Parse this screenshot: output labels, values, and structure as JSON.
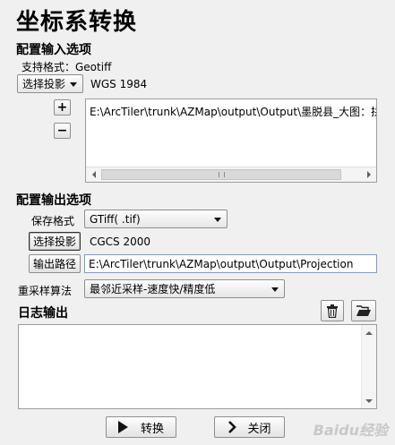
{
  "title": "坐标系转换",
  "input_section": {
    "heading": "配置输入选项",
    "support_format": "支持格式：Geotiff",
    "projection_combo": "选择投影",
    "projection_value": "WGS 1984",
    "add_label": "+",
    "remove_label": "−",
    "file_path": "E:\\ArcTiler\\trunk\\AZMap\\output\\Output\\墨脱县_大图：拼接"
  },
  "output_section": {
    "heading": "配置输出选项",
    "save_format_label": "保存格式",
    "save_format_value": "GTiff( .tif)",
    "projection_button": "选择投影",
    "projection_value": "CGCS 2000",
    "output_path_button": "输出路径",
    "output_path_value": "E:\\ArcTiler\\trunk\\AZMap\\output\\Output\\Projection",
    "resample_label": "重采样算法",
    "resample_value": "最邻近采样-速度快/精度低"
  },
  "log_section": {
    "heading": "日志输出"
  },
  "footer": {
    "convert_label": "转换",
    "close_label": "关闭"
  },
  "watermark": "Baidu经验"
}
